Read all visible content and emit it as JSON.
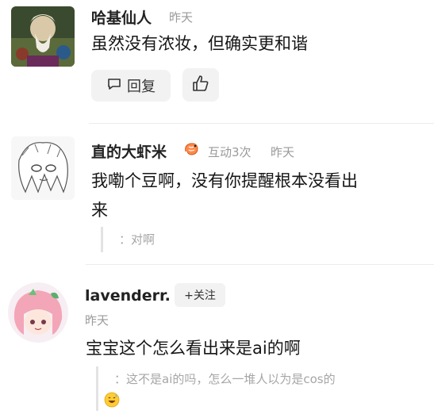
{
  "comments": [
    {
      "username": "哈基仙人",
      "time": "昨天",
      "text": "虽然没有浓妆，但确实更和谐",
      "reply_label": "回复"
    },
    {
      "username": "直的大虾米",
      "badge_icon": "shrimp-emoji-icon",
      "interactions": "互动3次",
      "time": "昨天",
      "text_line1": "我嘞个豆啊，没有你提醒根本没看出",
      "text_line2": "来",
      "quote": "：对啊"
    },
    {
      "username": "lavenderr.",
      "follow_label": "+关注",
      "time": "昨天",
      "text": "宝宝这个怎么看出来是ai的啊",
      "quote": "：这不是ai的吗，怎么一堆人以为是cos的",
      "quote_emoji_icon": "sweat-smile-emoji-icon"
    }
  ],
  "colors": {
    "meta_gray": "#9a9a9a",
    "button_bg": "#f2f2f2",
    "quote_bar": "#e3e3e3"
  }
}
